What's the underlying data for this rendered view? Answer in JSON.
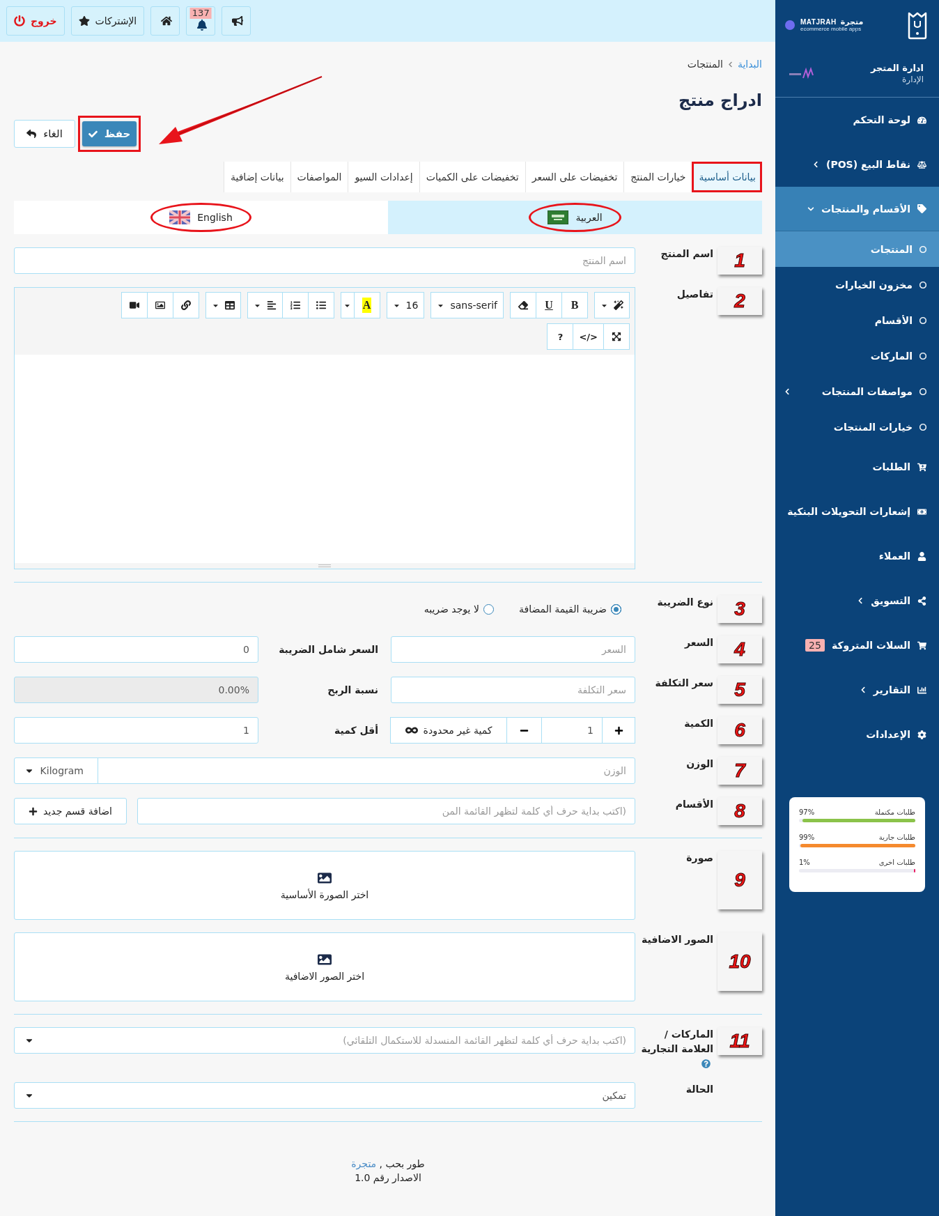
{
  "sidebar": {
    "brand": {
      "latin": "MATJRAH",
      "tagline": "ecommerce mobile apps",
      "arabic": "متجرة"
    },
    "store": {
      "name": "ادارة المتجر",
      "role": "الإدارة"
    },
    "items": [
      {
        "label": "لوحة التحكم",
        "selected": false
      },
      {
        "label": "نقاط البيع (POS)",
        "expanded": false,
        "selected": false
      },
      {
        "label": "الأقسام والمنتجات",
        "expanded": true,
        "selected": false,
        "children": [
          {
            "label": "المنتجات",
            "selected": true
          },
          {
            "label": "مخزون الخيارات",
            "selected": false
          },
          {
            "label": "الأقسام",
            "selected": false
          },
          {
            "label": "الماركات",
            "selected": false
          },
          {
            "label": "مواصفات المنتجات",
            "expanded": false,
            "selected": false
          },
          {
            "label": "خيارات المنتجات",
            "selected": false
          }
        ]
      },
      {
        "label": "الطلبات",
        "selected": false
      },
      {
        "label": "إشعارات التحويلات البنكية",
        "selected": false
      },
      {
        "label": "العملاء",
        "selected": false
      },
      {
        "label": "التسويق",
        "expanded": false,
        "selected": false
      },
      {
        "label": "السلات المتروكة",
        "badge": "25",
        "selected": false
      },
      {
        "label": "التقارير",
        "expanded": false,
        "selected": false
      },
      {
        "label": "الإعدادات",
        "selected": false
      }
    ],
    "stats": [
      {
        "label": "طلبات مكتملة",
        "reading": "97%",
        "level": 0.97,
        "color": "#8bc34a"
      },
      {
        "label": "طلبات جارية",
        "reading": "99%",
        "level": 0.99,
        "color": "#f58a2e"
      },
      {
        "label": "طلبات اخرى",
        "reading": "1%",
        "level": 0.01,
        "color": "#e91e63"
      }
    ]
  },
  "topbar": {
    "buttons": [
      {
        "kind": "announce"
      },
      {
        "kind": "notifications",
        "badge": "137"
      },
      {
        "kind": "home"
      },
      {
        "kind": "subscriptions",
        "label": "الإشتركات"
      },
      {
        "kind": "logout",
        "label": "خروج"
      }
    ]
  },
  "breadcrumb": [
    {
      "label": "البداية",
      "link": true
    },
    {
      "label": "المنتجات",
      "link": false
    }
  ],
  "title": "ادراج منتج",
  "actions": {
    "save": {
      "label": "حفظ",
      "annotated": true,
      "arrow": true
    },
    "cancel": {
      "label": "الغاء"
    }
  },
  "tabs": [
    {
      "label": "بيانات أساسية",
      "selected": true,
      "annotated": true
    },
    {
      "label": "خيارات المنتج",
      "selected": false,
      "annotated": false
    },
    {
      "label": "تخفيضات على السعر",
      "selected": false,
      "annotated": false
    },
    {
      "label": "تخفيضات على الكميات",
      "selected": false,
      "annotated": false
    },
    {
      "label": "إعدادات السيو",
      "selected": false,
      "annotated": false
    },
    {
      "label": "المواصفات",
      "selected": false,
      "annotated": false
    },
    {
      "label": "بيانات إضافية",
      "selected": false,
      "annotated": false
    }
  ],
  "languages": [
    {
      "kind": "arabic",
      "label": "العربية",
      "selected": true,
      "annotated": true
    },
    {
      "kind": "english",
      "label": "English",
      "selected": false,
      "annotated": true
    }
  ],
  "form": {
    "rows": [
      {
        "kind": "text",
        "label": "اسم المنتج",
        "callout": "1",
        "placeholder": "اسم المنتج"
      },
      {
        "kind": "editor",
        "label": "تفاصيل",
        "callout": "2",
        "toolbar": [
          [
            [
              {
                "kind": "style"
              }
            ],
            [
              {
                "kind": "bold",
                "label": "B"
              },
              {
                "kind": "underline",
                "label": "U"
              },
              {
                "kind": "eraser"
              }
            ],
            [
              {
                "kind": "font",
                "label": "sans-serif"
              }
            ],
            [
              {
                "kind": "size",
                "label": "16"
              }
            ],
            [
              {
                "kind": "color",
                "label": "A"
              },
              {
                "kind": "caret"
              }
            ],
            [
              {
                "kind": "ul"
              },
              {
                "kind": "ol"
              },
              {
                "kind": "align"
              }
            ],
            [
              {
                "kind": "table"
              }
            ],
            [
              {
                "kind": "link"
              },
              {
                "kind": "picture"
              },
              {
                "kind": "video"
              }
            ]
          ],
          [
            [
              {
                "kind": "fullscreen"
              },
              {
                "kind": "code",
                "label": "</>"
              },
              {
                "kind": "help",
                "label": "?"
              }
            ]
          ]
        ]
      },
      {
        "kind": "divider"
      },
      {
        "kind": "radio",
        "label": "نوع الضريبة",
        "callout": "3",
        "options": [
          {
            "label": "ضريبة القيمة المضافة",
            "selected": true
          },
          {
            "label": "لا يوجد ضريبه",
            "selected": false
          }
        ]
      },
      {
        "kind": "pair",
        "label": "السعر",
        "callout": "4",
        "placeholder": "السعر",
        "side_label": "السعر شامل الضريبة",
        "side_value": "0",
        "side_disabled": false
      },
      {
        "kind": "pair",
        "label": "سعر التكلفة",
        "callout": "5",
        "placeholder": "سعر التكلفة",
        "side_label": "نسبة الربح",
        "side_value": "0.00%",
        "side_disabled": true
      },
      {
        "kind": "quantity",
        "label": "الكمية",
        "callout": "6",
        "value": "1",
        "unlimited": "كمية غير محدودة",
        "side_label": "أقل كمية",
        "side_value": "1"
      },
      {
        "kind": "weight",
        "label": "الوزن",
        "callout": "7",
        "placeholder": "الوزن",
        "unit": "Kilogram"
      },
      {
        "kind": "categories",
        "label": "الأقسام",
        "callout": "8",
        "placeholder": "(اكتب بداية حرف أي كلمة لتظهر القائمة المن",
        "button": "اضافة قسم جديد"
      },
      {
        "kind": "divider"
      },
      {
        "kind": "upload",
        "label": "صورة",
        "callout": "9",
        "text": "اختر الصورة الأساسية"
      },
      {
        "kind": "upload",
        "label": "الصور الاضافية",
        "callout": "10",
        "text": "اختر الصور الاضافية"
      },
      {
        "kind": "divider"
      },
      {
        "kind": "select",
        "label": "الماركات / العلامة التجارية",
        "help": true,
        "callout": "11",
        "placeholder": "(اكتب بداية حرف أي كلمة لتظهر القائمة المنسدلة للاستكمال التلقائي)"
      },
      {
        "kind": "select",
        "label": "الحالة",
        "value": "تمكين"
      },
      {
        "kind": "divider"
      }
    ]
  },
  "footer": {
    "credit": "طور بحب ,",
    "link": "متجرة",
    "version": "الاصدار رقم 1.0"
  }
}
